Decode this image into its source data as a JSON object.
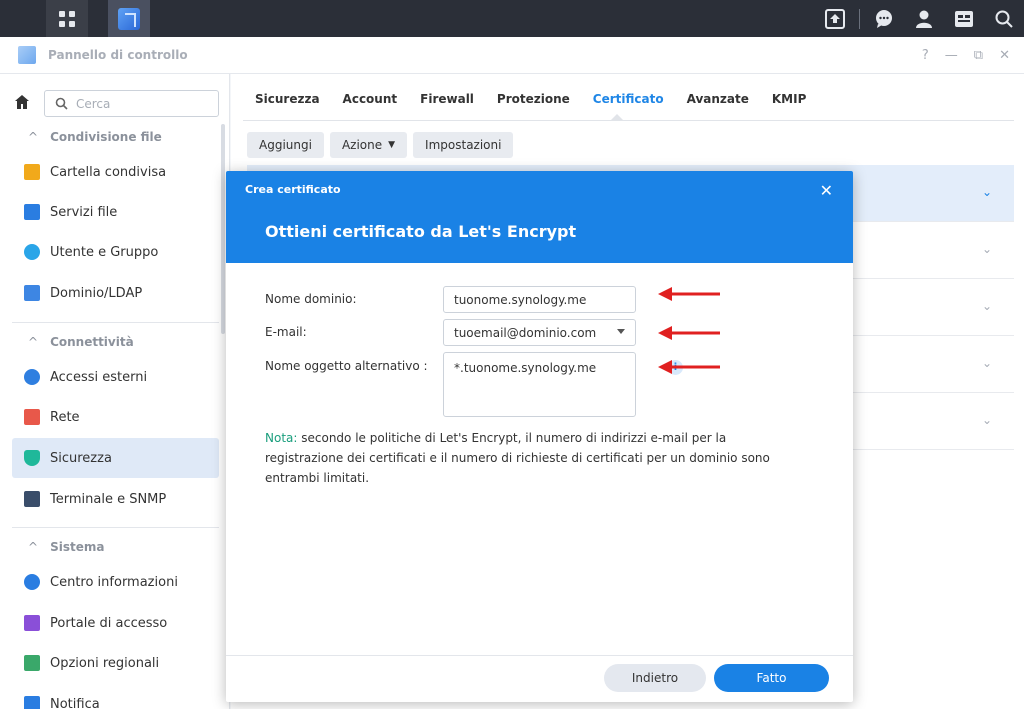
{
  "window": {
    "title": "Pannello di controllo"
  },
  "sidebar": {
    "search_placeholder": "Cerca",
    "sections": [
      {
        "label": "Condivisione file",
        "items": [
          "Cartella condivisa",
          "Servizi file",
          "Utente e Gruppo",
          "Dominio/LDAP"
        ]
      },
      {
        "label": "Connettività",
        "items": [
          "Accessi esterni",
          "Rete",
          "Sicurezza",
          "Terminale e SNMP"
        ]
      },
      {
        "label": "Sistema",
        "items": [
          "Centro informazioni",
          "Portale di accesso",
          "Opzioni regionali",
          "Notifica"
        ]
      }
    ],
    "active_item": "Sicurezza"
  },
  "tabs": [
    "Sicurezza",
    "Account",
    "Firewall",
    "Protezione",
    "Certificato",
    "Avanzate",
    "KMIP"
  ],
  "active_tab": "Certificato",
  "toolbar": {
    "add": "Aggiungi",
    "action": "Azione",
    "settings": "Impostazioni"
  },
  "dialog": {
    "small_title": "Crea certificato",
    "title": "Ottieni certificato da Let's Encrypt",
    "fields": {
      "domain_label": "Nome dominio:",
      "domain_value": "tuonome.synology.me",
      "email_label": "E-mail:",
      "email_value": "tuoemail@dominio.com",
      "alt_label": "Nome oggetto alternativo :",
      "alt_value": "*.tuonome.synology.me"
    },
    "info_icon": "i",
    "note_label": "Nota:",
    "note_text": "secondo le politiche di Let's Encrypt, il numero di indirizzi e-mail per la registrazione dei certificati e il numero di richieste di certificati per un dominio sono entrambi limitati.",
    "back_button": "Indietro",
    "done_button": "Fatto"
  },
  "colors": {
    "accent": "#1a82e5",
    "note": "#1a9e7d",
    "arrow": "#e02020"
  }
}
